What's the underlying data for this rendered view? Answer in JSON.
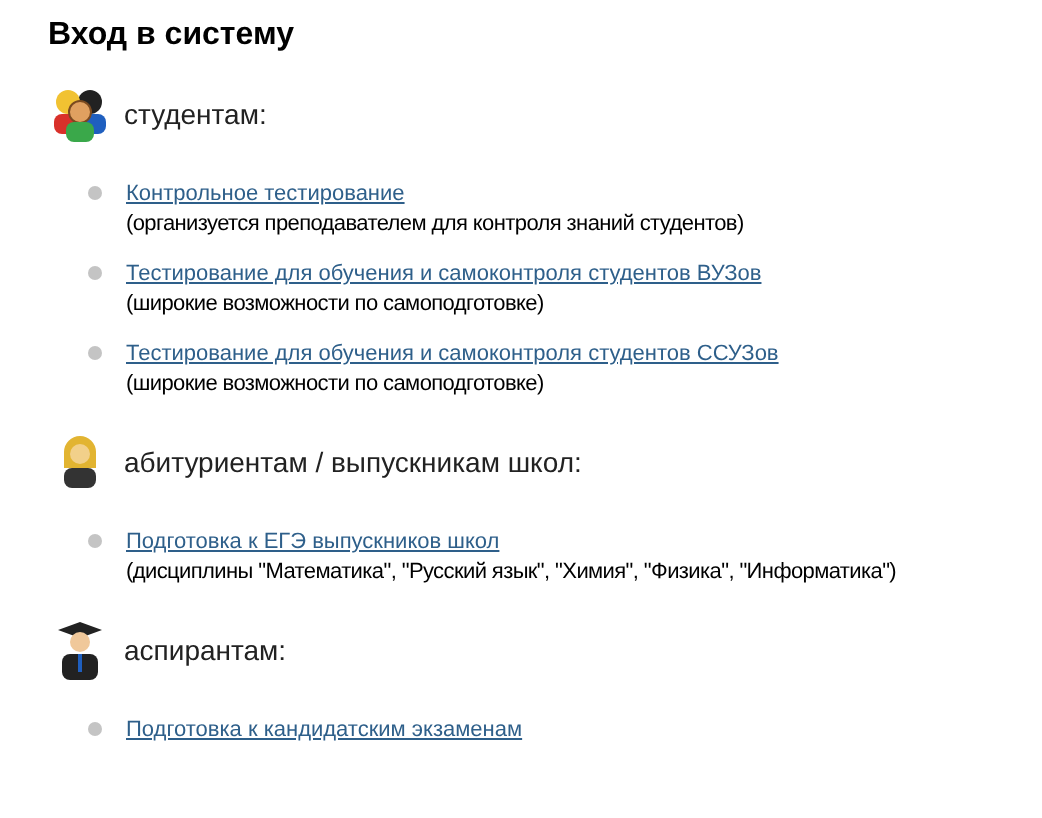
{
  "title": "Вход в систему",
  "groups": [
    {
      "kind": "students",
      "label": "студентам:",
      "items": [
        {
          "link": "Контрольное тестирование",
          "note": "(организуется преподавателем для контроля знаний студентов)"
        },
        {
          "link": "Тестирование для обучения и самоконтроля студентов ВУЗов",
          "note": "(широкие возможности по самоподготовке)"
        },
        {
          "link": "Тестирование для обучения и самоконтроля студентов ССУЗов",
          "note": "(широкие возможности по самоподготовке)"
        }
      ]
    },
    {
      "kind": "applicant",
      "label": "абитуриентам / выпускникам школ:",
      "items": [
        {
          "link": "Подготовка к ЕГЭ выпускников школ",
          "note": "(дисциплины \"Математика\", \"Русский язык\", \"Химия\", \"Физика\", \"Информатика\")"
        }
      ]
    },
    {
      "kind": "graduate",
      "label": "аспирантам:",
      "items": [
        {
          "link": "Подготовка к кандидатским экзаменам"
        }
      ]
    }
  ]
}
